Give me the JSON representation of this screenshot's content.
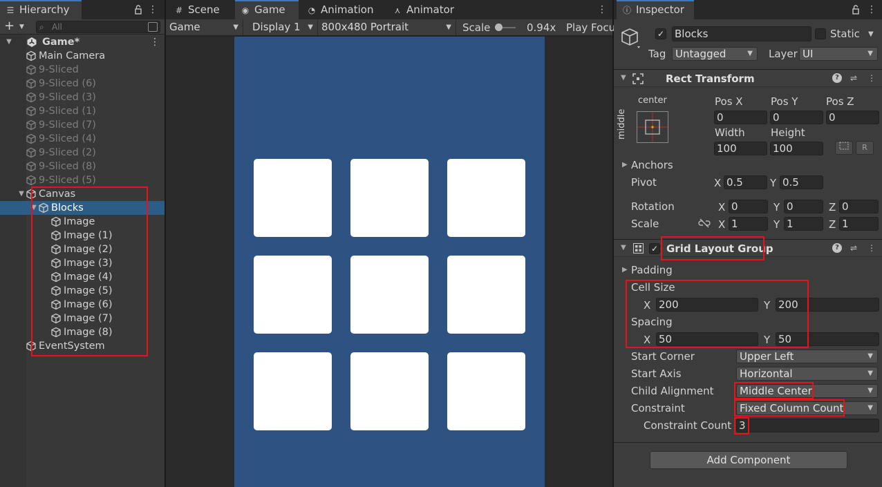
{
  "hierarchy": {
    "tab_label": "Hierarchy",
    "add_label": "+",
    "search_placeholder": "All",
    "items": [
      {
        "label": "Game*"
      },
      {
        "label": "Main Camera"
      },
      {
        "label": "9-Sliced"
      },
      {
        "label": "9-Sliced (6)"
      },
      {
        "label": "9-Sliced (3)"
      },
      {
        "label": "9-Sliced (1)"
      },
      {
        "label": "9-Sliced (7)"
      },
      {
        "label": "9-Sliced (4)"
      },
      {
        "label": "9-Sliced (2)"
      },
      {
        "label": "9-Sliced (8)"
      },
      {
        "label": "9-Sliced (5)"
      },
      {
        "label": "Canvas"
      },
      {
        "label": "Blocks"
      },
      {
        "label": "Image"
      },
      {
        "label": "Image (1)"
      },
      {
        "label": "Image (2)"
      },
      {
        "label": "Image (3)"
      },
      {
        "label": "Image (4)"
      },
      {
        "label": "Image (5)"
      },
      {
        "label": "Image (6)"
      },
      {
        "label": "Image (7)"
      },
      {
        "label": "Image (8)"
      },
      {
        "label": "EventSystem"
      }
    ]
  },
  "game_view": {
    "tabs": [
      {
        "label": "Scene",
        "icon": "grid-icon"
      },
      {
        "label": "Game",
        "icon": "gamepad-icon"
      },
      {
        "label": "Animation",
        "icon": "clock-icon"
      },
      {
        "label": "Animator",
        "icon": "animator-icon"
      }
    ],
    "toolbar": {
      "mode": "Game",
      "display": "Display 1",
      "resolution": "800x480 Portrait",
      "scale_label": "Scale",
      "scale_value": "0.94x",
      "scale_fraction": 0.05,
      "play_focused": "Play Focu"
    },
    "block_count": 9,
    "colors": {
      "canvas": "#2e5282",
      "block": "#ffffff"
    }
  },
  "inspector": {
    "tab_label": "Inspector",
    "object": {
      "name": "Blocks",
      "active": true,
      "static_label": "Static",
      "tag_label": "Tag",
      "tag_value": "Untagged",
      "layer_label": "Layer",
      "layer_value": "UI"
    },
    "rect_transform": {
      "title": "Rect Transform",
      "anchor_h": "center",
      "anchor_v": "middle",
      "pos_x_label": "Pos X",
      "pos_x": "0",
      "pos_y_label": "Pos Y",
      "pos_y": "0",
      "pos_z_label": "Pos Z",
      "pos_z": "0",
      "width_label": "Width",
      "width": "100",
      "height_label": "Height",
      "height": "100",
      "blueprint_label": "",
      "raw_label": "R",
      "anchors_label": "Anchors",
      "pivot_label": "Pivot",
      "pivot_x": "0.5",
      "pivot_y": "0.5",
      "rotation_label": "Rotation",
      "rot_x": "0",
      "rot_y": "0",
      "rot_z": "0",
      "scale_label": "Scale",
      "scale_x": "1",
      "scale_y": "1",
      "scale_z": "1"
    },
    "grid_layout": {
      "title": "Grid Layout Group",
      "enabled": true,
      "padding_label": "Padding",
      "cell_size_label": "Cell Size",
      "cell_x": "200",
      "cell_y": "200",
      "spacing_label": "Spacing",
      "spacing_x": "50",
      "spacing_y": "50",
      "start_corner_label": "Start Corner",
      "start_corner": "Upper Left",
      "start_axis_label": "Start Axis",
      "start_axis": "Horizontal",
      "child_alignment_label": "Child Alignment",
      "child_alignment": "Middle Center",
      "constraint_label": "Constraint",
      "constraint": "Fixed Column Count",
      "constraint_count_label": "Constraint Count",
      "constraint_count": "3"
    },
    "axis_labels": {
      "x": "X",
      "y": "Y",
      "z": "Z"
    },
    "add_component_label": "Add Component"
  },
  "colors": {
    "highlight": "#e8121b",
    "selection": "#2c5d87",
    "accent_tab": "#3a79bb"
  }
}
